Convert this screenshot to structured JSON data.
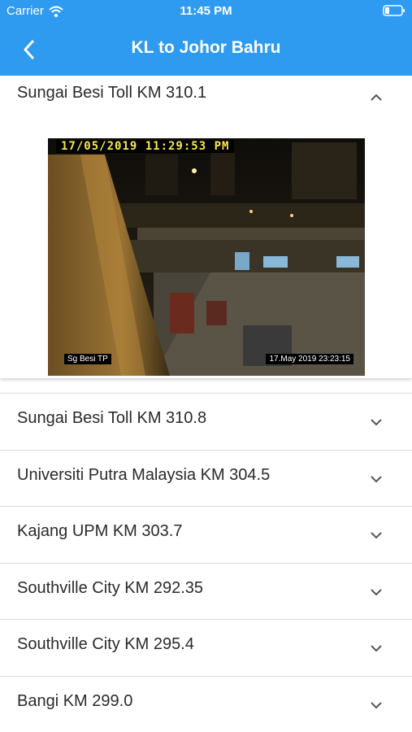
{
  "status_bar": {
    "carrier": "Carrier",
    "time": "11:45 PM"
  },
  "nav": {
    "title": "KL to Johor Bahru"
  },
  "expanded_item": {
    "title": "Sungai Besi Toll KM 310.1",
    "camera": {
      "timestamp": "17/05/2019 11:29:53 PM",
      "location_label": "Sg Besi TP",
      "date_label": "17.May 2019  23:23:15"
    }
  },
  "items": [
    {
      "title": "Sungai Besi Toll KM 310.8"
    },
    {
      "title": "Universiti Putra Malaysia KM 304.5"
    },
    {
      "title": "Kajang UPM KM 303.7"
    },
    {
      "title": "Southville City KM 292.35"
    },
    {
      "title": "Southville City KM 295.4"
    },
    {
      "title": "Bangi KM 299.0"
    }
  ],
  "colors": {
    "header": "#2f9bf0",
    "chevron": "#555555"
  }
}
